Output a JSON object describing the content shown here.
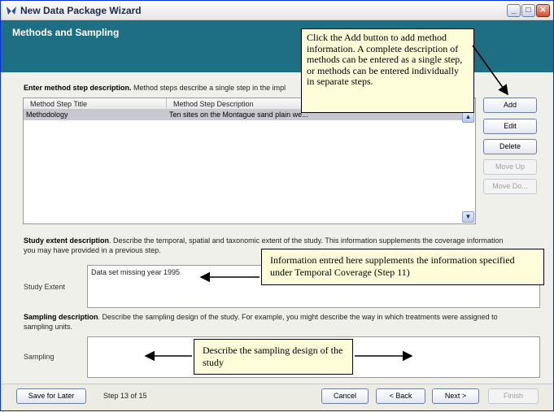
{
  "window": {
    "title": "New Data Package Wizard"
  },
  "header": {
    "title": "Methods and Sampling"
  },
  "methods": {
    "label_bold": "Enter method step description.",
    "label_rest": " Method steps describe a single step in the impl",
    "columns": [
      "Method Step Title",
      "Method Step Description"
    ],
    "rows": [
      {
        "title": "Methodology",
        "description": "Ten sites on the Montague sand plain we..."
      }
    ],
    "buttons": {
      "add": "Add",
      "edit": "Edit",
      "delete": "Delete",
      "move_up": "Move Up",
      "move_down": "Move Do..."
    }
  },
  "study_extent": {
    "label_bold": "Study extent description",
    "label_rest": ". Describe the temporal, spatial and taxonomic extent of the study. This information supplements the coverage information",
    "label_line2": "you may have provided in a previous step.",
    "field_label": "Study Extent",
    "value": "Data set missing year 1995"
  },
  "sampling": {
    "label_bold": "Sampling description",
    "label_rest": ". Describe the sampling design of the study. For example, you might describe the way in which treatments were assigned to",
    "label_line2": "sampling units.",
    "field_label": "Sampling",
    "value": ""
  },
  "callouts": {
    "add": "Click the Add button to add method information. A complete description of methods can be entered as a single step, or methods can be entered individually in separate steps.",
    "extent": "Information entred here supplements the information specified under Temporal Coverage (Step 11)",
    "sampling": "Describe the sampling design of the study"
  },
  "footer": {
    "save_later": "Save for Later",
    "step": "Step 13 of 15",
    "cancel": "Cancel",
    "back": "< Back",
    "next": "Next >",
    "finish": "Finish"
  }
}
